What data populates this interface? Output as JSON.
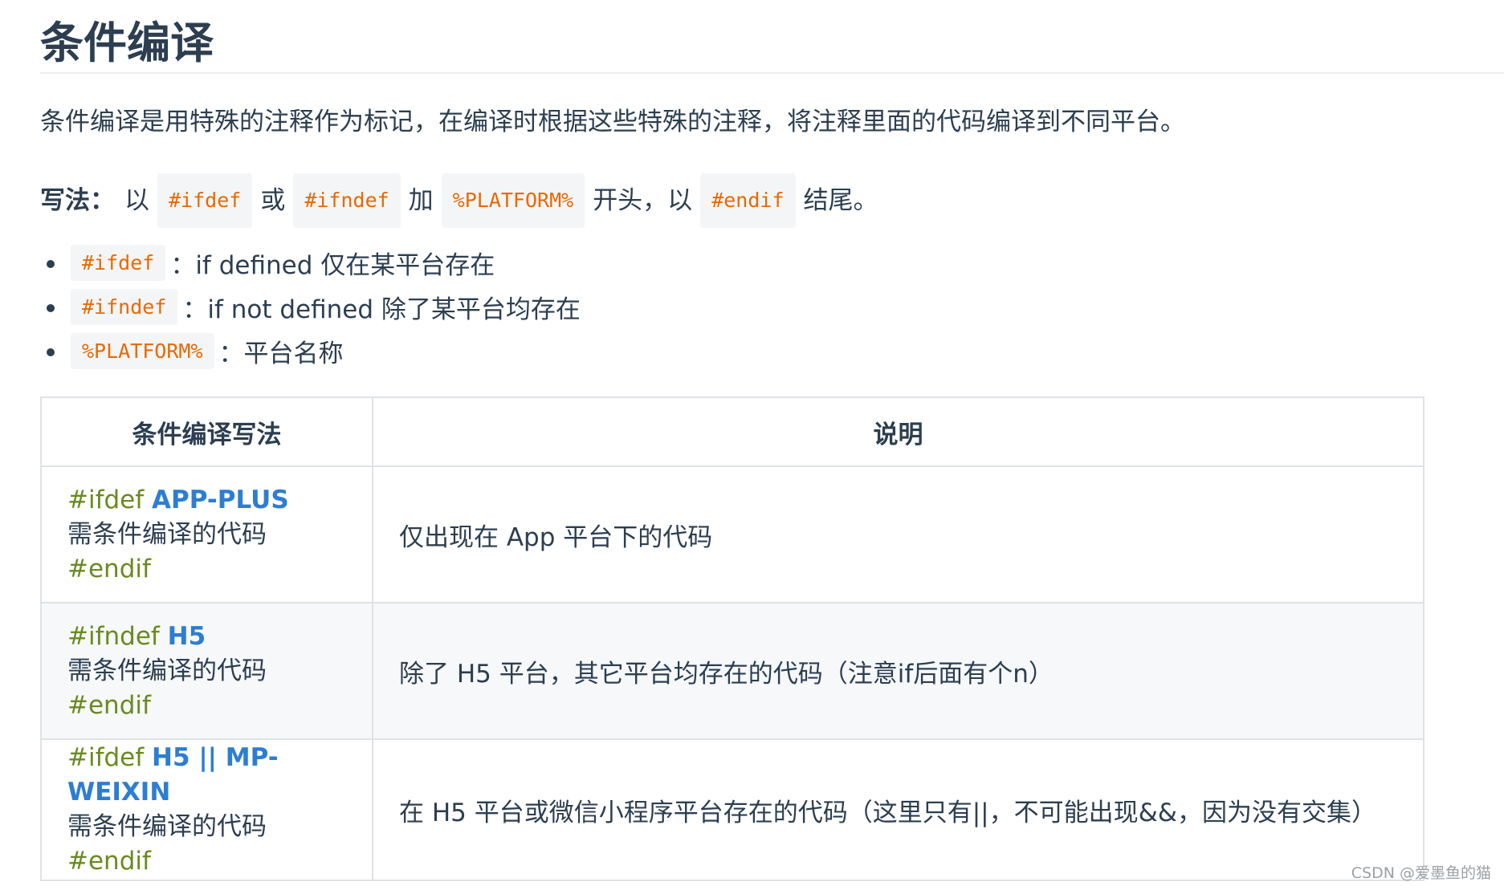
{
  "heading": "条件编译",
  "intro": "条件编译是用特殊的注释作为标记，在编译时根据这些特殊的注释，将注释里面的代码编译到不同平台。",
  "usage": {
    "label": "写法：",
    "t1": "以",
    "c1": "#ifdef",
    "t2": "或",
    "c2": "#ifndef",
    "t3": "加",
    "c3": "%PLATFORM%",
    "t4": "开头，以",
    "c4": "#endif",
    "t5": "结尾。"
  },
  "defs": [
    {
      "code": "#ifdef",
      "sep": "：",
      "text": "if defined 仅在某平台存在"
    },
    {
      "code": "#ifndef",
      "sep": "：",
      "text": "if not defined 除了某平台均存在"
    },
    {
      "code": "%PLATFORM%",
      "sep": "：",
      "text": "平台名称"
    }
  ],
  "table": {
    "headers": [
      "条件编译写法",
      "说明"
    ],
    "rows": [
      {
        "directive": "#ifdef",
        "platform": "APP-PLUS",
        "body": "需条件编译的代码",
        "end": "#endif",
        "desc": "仅出现在 App 平台下的代码"
      },
      {
        "directive": "#ifndef",
        "platform": "H5",
        "body": "需条件编译的代码",
        "end": "#endif",
        "desc": "除了 H5 平台，其它平台均存在的代码（注意if后面有个n）"
      },
      {
        "directive": "#ifdef",
        "platform": "H5 || MP-WEIXIN",
        "body": "需条件编译的代码",
        "end": "#endif",
        "desc": "在 H5 平台或微信小程序平台存在的代码（这里只有||，不可能出现&&，因为没有交集）"
      }
    ]
  },
  "watermark": "CSDN @爱墨鱼的猫"
}
